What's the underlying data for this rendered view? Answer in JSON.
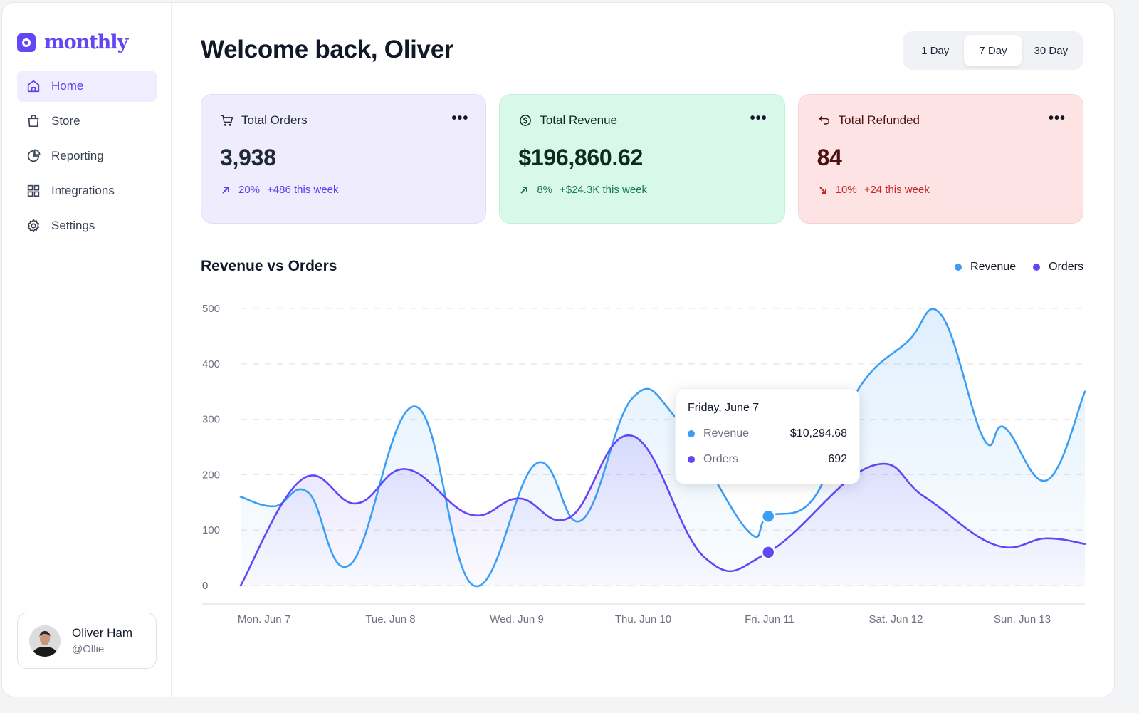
{
  "app": {
    "name": "monthly"
  },
  "sidebar": {
    "items": [
      {
        "label": "Home",
        "icon": "home-icon",
        "active": true
      },
      {
        "label": "Store",
        "icon": "shopping-bag-icon",
        "active": false
      },
      {
        "label": "Reporting",
        "icon": "pie-chart-icon",
        "active": false
      },
      {
        "label": "Integrations",
        "icon": "grid-icon",
        "active": false
      },
      {
        "label": "Settings",
        "icon": "gear-icon",
        "active": false
      }
    ],
    "user": {
      "name": "Oliver Ham",
      "handle": "@Ollie"
    }
  },
  "header": {
    "title": "Welcome back, Oliver",
    "range_options": [
      "1 Day",
      "7 Day",
      "30 Day"
    ],
    "range_selected": "7 Day"
  },
  "cards": [
    {
      "title": "Total Orders",
      "icon": "cart-icon",
      "value": "3,938",
      "delta_direction": "up",
      "delta_pct": "20%",
      "delta_text": "+486 this week",
      "more": "•••"
    },
    {
      "title": "Total Revenue",
      "icon": "dollar-circle-icon",
      "value": "$196,860.62",
      "delta_direction": "up",
      "delta_pct": "8%",
      "delta_text": "+$24.3K this week",
      "more": "•••"
    },
    {
      "title": "Total Refunded",
      "icon": "refund-arrow-icon",
      "value": "84",
      "delta_direction": "down",
      "delta_pct": "10%",
      "delta_text": "+24 this week",
      "more": "•••"
    }
  ],
  "colors": {
    "revenue": "#3b9ef5",
    "orders": "#6247f5",
    "accent": "#5b3ff0"
  },
  "tooltip": {
    "title": "Friday, June 7",
    "rows": [
      {
        "label": "Revenue",
        "value": "$10,294.68"
      },
      {
        "label": "Orders",
        "value": "692"
      }
    ]
  },
  "chart_data": {
    "type": "area",
    "title": "Revenue vs Orders",
    "categories": [
      "Mon. Jun 7",
      "Tue. Jun 8",
      "Wed. Jun 9",
      "Thu. Jun 10",
      "Fri. Jun 11",
      "Sat. Jun 12",
      "Sun. Jun 13"
    ],
    "yticks": [
      0,
      100,
      200,
      300,
      400,
      500
    ],
    "ylim": [
      0,
      500
    ],
    "xlim": [
      0,
      1
    ],
    "grid": true,
    "legend_position": "top-right",
    "series": [
      {
        "name": "Revenue",
        "x": [
          0,
          0.04,
          0.08,
          0.13,
          0.207,
          0.276,
          0.35,
          0.404,
          0.464,
          0.517,
          0.6,
          0.625,
          0.68,
          0.73,
          0.79,
          0.83,
          0.88,
          0.905,
          0.955,
          1
        ],
        "values": [
          160,
          143,
          168,
          38,
          323,
          0,
          220,
          118,
          338,
          300,
          100,
          125,
          160,
          350,
          440,
          488,
          265,
          285,
          190,
          350
        ]
      },
      {
        "name": "Orders",
        "x": [
          0,
          0.073,
          0.137,
          0.196,
          0.272,
          0.33,
          0.39,
          0.464,
          0.55,
          0.625,
          0.746,
          0.81,
          0.894,
          0.954,
          1
        ],
        "values": [
          0,
          192,
          148,
          210,
          128,
          157,
          123,
          270,
          50,
          60,
          215,
          160,
          73,
          85,
          75
        ]
      }
    ],
    "highlight": {
      "x": 0.625,
      "revenue": 125,
      "orders": 60
    }
  }
}
